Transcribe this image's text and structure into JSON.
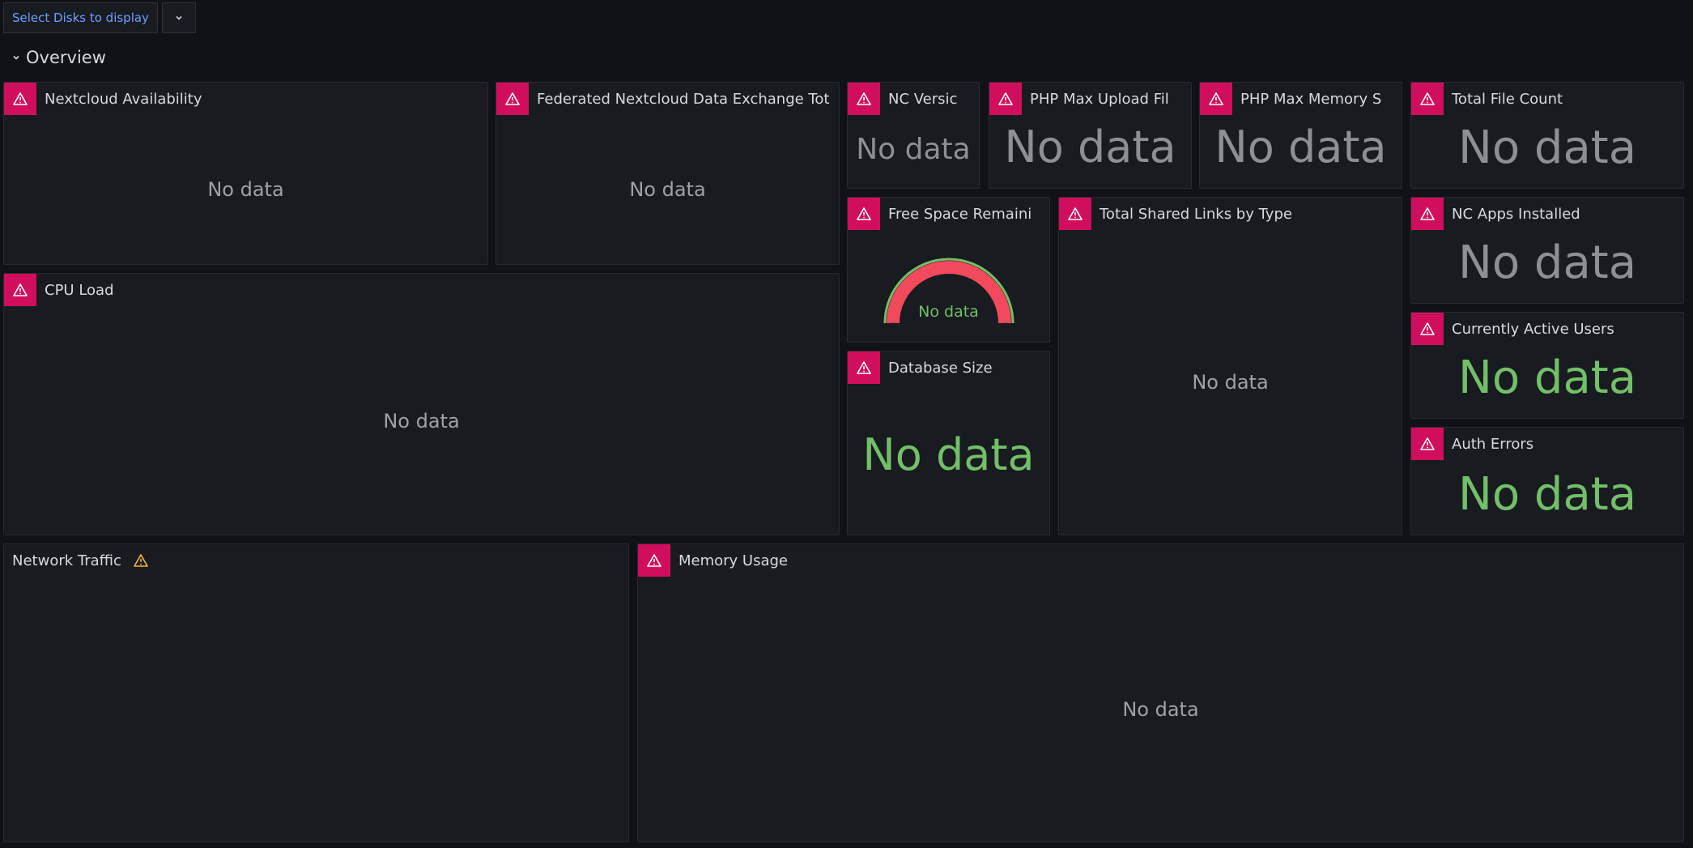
{
  "variables": {
    "disk_select_label": "Select Disks to display"
  },
  "row": {
    "title": "Overview"
  },
  "no_data": "No data",
  "panels": {
    "nextcloud_availability": "Nextcloud Availability",
    "federated_exchange": "Federated Nextcloud Data Exchange Tot",
    "nc_version": "NC Versic",
    "php_max_upload": "PHP Max Upload Fil",
    "php_max_memory": "PHP Max Memory S",
    "total_file_count": "Total File Count",
    "free_space": "Free Space Remaini",
    "total_shared_links": "Total Shared Links by Type",
    "nc_apps_installed": "NC Apps Installed",
    "cpu_load": "CPU Load",
    "currently_active_users": "Currently Active Users",
    "database_size": "Database Size",
    "auth_errors": "Auth Errors",
    "network_traffic": "Network Traffic",
    "memory_usage": "Memory Usage"
  },
  "colors": {
    "error_badge": "#d10e5c",
    "ok_green": "#73bf69",
    "gauge_red": "#f2495c",
    "warning": "#f5b73d",
    "link_blue": "#6e9fff"
  },
  "icons": {
    "error": "alert-triangle-icon",
    "warning": "warning-icon",
    "caret": "chevron-down-icon"
  }
}
